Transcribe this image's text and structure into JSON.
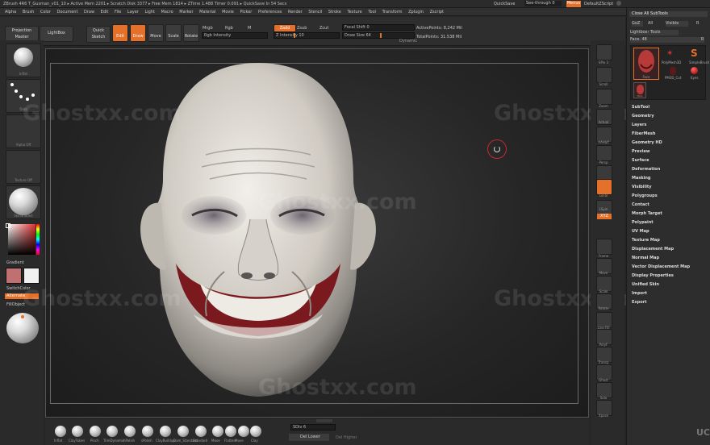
{
  "titlebar": {
    "text": "ZBrush 4R6   T_Gusman_v01_10  ▸ Active Mem 2201 ▸ Scratch Disk 3377 ▸ Free Mem 1814 ▸ ZTime 1.488 Timer 0.091 ▸ QuickSave In 54 Secs",
    "quicksave": "QuickSave",
    "seethrough": "See-through  0",
    "menus": "Menus",
    "script": "DefaultZScript"
  },
  "menubar": [
    "Alpha",
    "Brush",
    "Color",
    "Document",
    "Draw",
    "Edit",
    "File",
    "Layer",
    "Light",
    "Macro",
    "Marker",
    "Material",
    "Movie",
    "Picker",
    "Preferences",
    "Render",
    "Stencil",
    "Stroke",
    "Texture",
    "Tool",
    "Transform",
    "Zplugin",
    "Zscript"
  ],
  "toolbar": {
    "projection_master": "Projection Master",
    "lightbox": "LightBox",
    "quick_sketch": "Quick Sketch",
    "edit": "Edit",
    "draw": "Draw",
    "move": "Move",
    "scale": "Scale",
    "rotate": "Rotate",
    "mrgb": "Mrgb",
    "rgb": "Rgb",
    "m": "M",
    "rgb_intensity": "Rgb Intensity",
    "zadd": "Zadd",
    "zsub": "Zsub",
    "zcut": "Zcut",
    "z_intensity": "Z Intensity 10",
    "focal_shift": "Focal Shift 0",
    "draw_size": "Draw Size 64",
    "dynamic": "Dynamic",
    "active_points": "ActivePoints: 8,242 Mil",
    "total_points": "TotalPoints: 31.538 Mil"
  },
  "leftshelf": {
    "brush_label": "Inflat",
    "stroke_label": "Dots",
    "alpha_label": "Alpha Off",
    "texture_label": "Texture Off",
    "material_label": "SkinShade4",
    "gradient": "Gradient",
    "switch_color": "SwitchColor",
    "alternate": "Alternate",
    "fill_object": "FillObject"
  },
  "rightshelf": [
    "SPix 3",
    "Scroll",
    "Zoom",
    "Actual",
    "AAHalf",
    "Persp",
    "Floor",
    "Local",
    "LSym",
    "XYZ",
    "Frame",
    "Move",
    "Scale",
    "Rotate",
    "Line Fill",
    "PolyF",
    "Transp",
    "Ghost",
    "Solo",
    "Xpose"
  ],
  "toolpalette": {
    "close_subtools": "Close All SubTools",
    "goz": "GoZ",
    "all": "All",
    "visible": "Visible",
    "r": "R",
    "lightbox_tools": "Lightbox› Tools",
    "current_tool": "Face. 48",
    "r2": "R",
    "thumbs": [
      "Face",
      "PolyMesh3D",
      "SimpleBrush",
      "PM3D_Cut",
      "Eyes",
      "Face"
    ],
    "items": [
      "SubTool",
      "Geometry",
      "Layers",
      "FiberMesh",
      "Geometry HD",
      "Preview",
      "Surface",
      "Deformation",
      "Masking",
      "Visibility",
      "Polygroups",
      "Contact",
      "Morph Target",
      "Polypaint",
      "UV Map",
      "Texture Map",
      "Displacement Map",
      "Normal Map",
      "Vector Displacement Map",
      "Display Properties",
      "Unified Skin",
      "Import",
      "Export"
    ]
  },
  "bottombar": {
    "brushes": [
      "Inflat",
      "ClayTubes",
      "Pinch",
      "TrimDynamic",
      "hPolish",
      "sPolish",
      "ClayBuildup",
      "Dam_Standard",
      "Standard",
      "Move",
      "Flatten",
      "Move",
      "Clay"
    ],
    "sdiv": "SDiv 6",
    "del_lower": "Del Lower",
    "del_higher": "Del Higher"
  },
  "watermark": "Ghostxx.com",
  "corner_text": "UC",
  "colors": {
    "accent": "#e4702a",
    "face_base": "#d8d4cc",
    "lip_red": "#7a1a1e"
  }
}
